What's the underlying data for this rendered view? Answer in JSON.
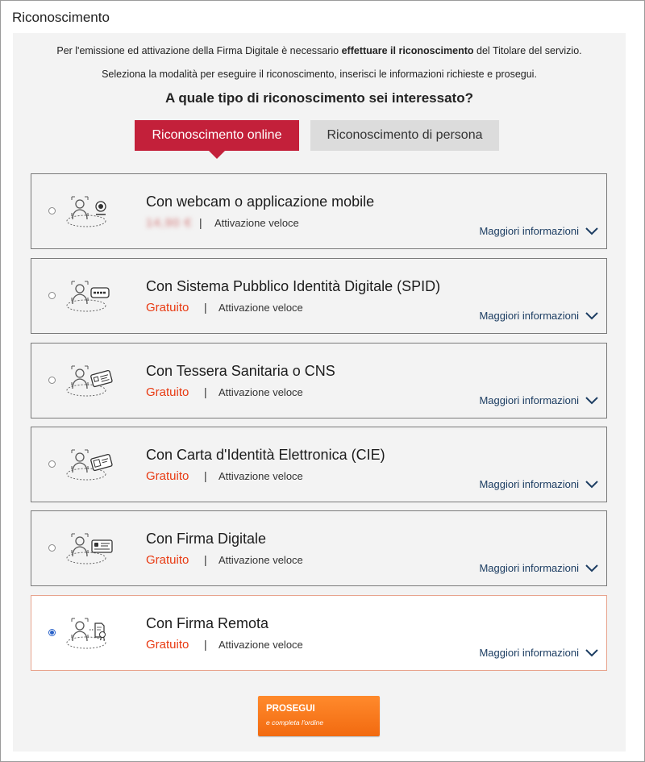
{
  "page": {
    "title": "Riconoscimento"
  },
  "intro": {
    "line1_pre": "Per l'emissione ed attivazione della Firma Digitale è necessario ",
    "line1_bold": "effettuare il riconoscimento",
    "line1_post": " del Titolare del servizio.",
    "line2": "Seleziona la modalità per eseguire il riconoscimento, inserisci le informazioni richieste e prosegui."
  },
  "question": "A quale tipo di riconoscimento sei interessato?",
  "tabs": {
    "online": "Riconoscimento online",
    "persona": "Riconoscimento di persona"
  },
  "options": [
    {
      "title": "Con webcam o applicazione mobile",
      "price": "14,90 €",
      "separator": "|",
      "activation": "Attivazione veloce",
      "more": "Maggiori informazioni",
      "icon": "webcam-icon",
      "selected": false
    },
    {
      "title": "Con Sistema Pubblico Identità Digitale (SPID)",
      "price": "Gratuito",
      "separator": "|",
      "activation": "Attivazione veloce",
      "more": "Maggiori informazioni",
      "icon": "spid-icon",
      "selected": false
    },
    {
      "title": "Con Tessera Sanitaria o CNS",
      "price": "Gratuito",
      "separator": "|",
      "activation": "Attivazione veloce",
      "more": "Maggiori informazioni",
      "icon": "health-card-icon",
      "selected": false
    },
    {
      "title": "Con Carta d'Identità Elettronica (CIE)",
      "price": "Gratuito",
      "separator": "|",
      "activation": "Attivazione veloce",
      "more": "Maggiori informazioni",
      "icon": "id-card-icon",
      "selected": false
    },
    {
      "title": "Con Firma Digitale",
      "price": "Gratuito",
      "separator": "|",
      "activation": "Attivazione veloce",
      "more": "Maggiori informazioni",
      "icon": "smart-card-icon",
      "selected": false
    },
    {
      "title": "Con Firma Remota",
      "price": "Gratuito",
      "separator": "|",
      "activation": "Attivazione veloce",
      "more": "Maggiori informazioni",
      "icon": "remote-signature-icon",
      "selected": true
    }
  ],
  "button": {
    "label": "PROSEGUI",
    "sublabel": "e completa l'ordine"
  },
  "colors": {
    "accent": "#c3203a",
    "price": "#e83a12",
    "link": "#1c3d62",
    "button": "#f26a10"
  }
}
